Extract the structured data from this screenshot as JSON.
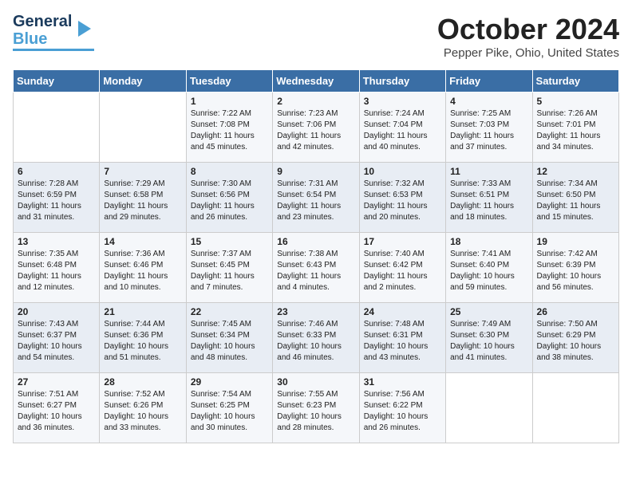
{
  "logo": {
    "part1": "General",
    "part2": "Blue"
  },
  "title": "October 2024",
  "location": "Pepper Pike, Ohio, United States",
  "days_header": [
    "Sunday",
    "Monday",
    "Tuesday",
    "Wednesday",
    "Thursday",
    "Friday",
    "Saturday"
  ],
  "weeks": [
    [
      {
        "day": "",
        "info": ""
      },
      {
        "day": "",
        "info": ""
      },
      {
        "day": "1",
        "info": "Sunrise: 7:22 AM\nSunset: 7:08 PM\nDaylight: 11 hours and 45 minutes."
      },
      {
        "day": "2",
        "info": "Sunrise: 7:23 AM\nSunset: 7:06 PM\nDaylight: 11 hours and 42 minutes."
      },
      {
        "day": "3",
        "info": "Sunrise: 7:24 AM\nSunset: 7:04 PM\nDaylight: 11 hours and 40 minutes."
      },
      {
        "day": "4",
        "info": "Sunrise: 7:25 AM\nSunset: 7:03 PM\nDaylight: 11 hours and 37 minutes."
      },
      {
        "day": "5",
        "info": "Sunrise: 7:26 AM\nSunset: 7:01 PM\nDaylight: 11 hours and 34 minutes."
      }
    ],
    [
      {
        "day": "6",
        "info": "Sunrise: 7:28 AM\nSunset: 6:59 PM\nDaylight: 11 hours and 31 minutes."
      },
      {
        "day": "7",
        "info": "Sunrise: 7:29 AM\nSunset: 6:58 PM\nDaylight: 11 hours and 29 minutes."
      },
      {
        "day": "8",
        "info": "Sunrise: 7:30 AM\nSunset: 6:56 PM\nDaylight: 11 hours and 26 minutes."
      },
      {
        "day": "9",
        "info": "Sunrise: 7:31 AM\nSunset: 6:54 PM\nDaylight: 11 hours and 23 minutes."
      },
      {
        "day": "10",
        "info": "Sunrise: 7:32 AM\nSunset: 6:53 PM\nDaylight: 11 hours and 20 minutes."
      },
      {
        "day": "11",
        "info": "Sunrise: 7:33 AM\nSunset: 6:51 PM\nDaylight: 11 hours and 18 minutes."
      },
      {
        "day": "12",
        "info": "Sunrise: 7:34 AM\nSunset: 6:50 PM\nDaylight: 11 hours and 15 minutes."
      }
    ],
    [
      {
        "day": "13",
        "info": "Sunrise: 7:35 AM\nSunset: 6:48 PM\nDaylight: 11 hours and 12 minutes."
      },
      {
        "day": "14",
        "info": "Sunrise: 7:36 AM\nSunset: 6:46 PM\nDaylight: 11 hours and 10 minutes."
      },
      {
        "day": "15",
        "info": "Sunrise: 7:37 AM\nSunset: 6:45 PM\nDaylight: 11 hours and 7 minutes."
      },
      {
        "day": "16",
        "info": "Sunrise: 7:38 AM\nSunset: 6:43 PM\nDaylight: 11 hours and 4 minutes."
      },
      {
        "day": "17",
        "info": "Sunrise: 7:40 AM\nSunset: 6:42 PM\nDaylight: 11 hours and 2 minutes."
      },
      {
        "day": "18",
        "info": "Sunrise: 7:41 AM\nSunset: 6:40 PM\nDaylight: 10 hours and 59 minutes."
      },
      {
        "day": "19",
        "info": "Sunrise: 7:42 AM\nSunset: 6:39 PM\nDaylight: 10 hours and 56 minutes."
      }
    ],
    [
      {
        "day": "20",
        "info": "Sunrise: 7:43 AM\nSunset: 6:37 PM\nDaylight: 10 hours and 54 minutes."
      },
      {
        "day": "21",
        "info": "Sunrise: 7:44 AM\nSunset: 6:36 PM\nDaylight: 10 hours and 51 minutes."
      },
      {
        "day": "22",
        "info": "Sunrise: 7:45 AM\nSunset: 6:34 PM\nDaylight: 10 hours and 48 minutes."
      },
      {
        "day": "23",
        "info": "Sunrise: 7:46 AM\nSunset: 6:33 PM\nDaylight: 10 hours and 46 minutes."
      },
      {
        "day": "24",
        "info": "Sunrise: 7:48 AM\nSunset: 6:31 PM\nDaylight: 10 hours and 43 minutes."
      },
      {
        "day": "25",
        "info": "Sunrise: 7:49 AM\nSunset: 6:30 PM\nDaylight: 10 hours and 41 minutes."
      },
      {
        "day": "26",
        "info": "Sunrise: 7:50 AM\nSunset: 6:29 PM\nDaylight: 10 hours and 38 minutes."
      }
    ],
    [
      {
        "day": "27",
        "info": "Sunrise: 7:51 AM\nSunset: 6:27 PM\nDaylight: 10 hours and 36 minutes."
      },
      {
        "day": "28",
        "info": "Sunrise: 7:52 AM\nSunset: 6:26 PM\nDaylight: 10 hours and 33 minutes."
      },
      {
        "day": "29",
        "info": "Sunrise: 7:54 AM\nSunset: 6:25 PM\nDaylight: 10 hours and 30 minutes."
      },
      {
        "day": "30",
        "info": "Sunrise: 7:55 AM\nSunset: 6:23 PM\nDaylight: 10 hours and 28 minutes."
      },
      {
        "day": "31",
        "info": "Sunrise: 7:56 AM\nSunset: 6:22 PM\nDaylight: 10 hours and 26 minutes."
      },
      {
        "day": "",
        "info": ""
      },
      {
        "day": "",
        "info": ""
      }
    ]
  ]
}
